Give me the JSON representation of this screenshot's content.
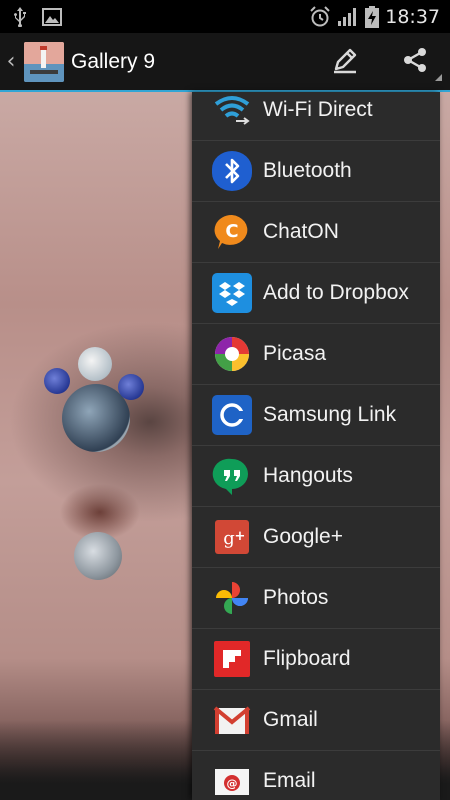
{
  "status_bar": {
    "time": "18:37",
    "icons": [
      "usb-icon",
      "image-icon",
      "alarm-icon",
      "signal-icon",
      "battery-charging-icon"
    ]
  },
  "action_bar": {
    "title": "Gallery 9",
    "actions": [
      "edit-icon",
      "share-icon"
    ]
  },
  "share_menu": {
    "items": [
      {
        "label": "Wi-Fi Direct",
        "icon": "wifi-direct-icon"
      },
      {
        "label": "Bluetooth",
        "icon": "bluetooth-icon"
      },
      {
        "label": "ChatON",
        "icon": "chaton-icon"
      },
      {
        "label": "Add to Dropbox",
        "icon": "dropbox-icon"
      },
      {
        "label": "Picasa",
        "icon": "picasa-icon"
      },
      {
        "label": "Samsung Link",
        "icon": "samsung-link-icon"
      },
      {
        "label": "Hangouts",
        "icon": "hangouts-icon"
      },
      {
        "label": "Google+",
        "icon": "google-plus-icon"
      },
      {
        "label": "Photos",
        "icon": "photos-icon"
      },
      {
        "label": "Flipboard",
        "icon": "flipboard-icon"
      },
      {
        "label": "Gmail",
        "icon": "gmail-icon"
      },
      {
        "label": "Email",
        "icon": "email-icon"
      }
    ]
  },
  "colors": {
    "accent": "#32a5d4",
    "popup_bg": "#2b2b2b",
    "divider": "#3c3c3c"
  }
}
